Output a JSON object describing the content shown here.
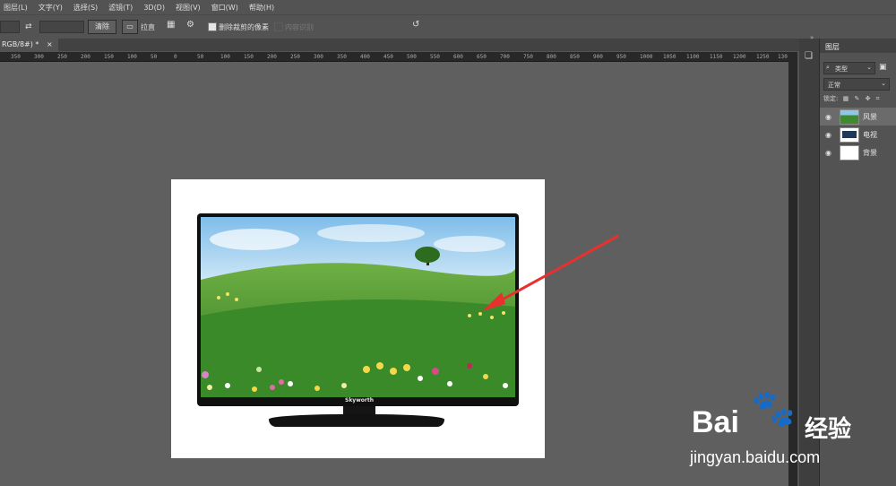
{
  "menubar": {
    "items": [
      "图层(L)",
      "文字(Y)",
      "选择(S)",
      "滤镜(T)",
      "3D(D)",
      "视图(V)",
      "窗口(W)",
      "帮助(H)"
    ]
  },
  "options": {
    "clear_label": "清除",
    "straighten_label": "拉直",
    "delete_cropped_label": "删除裁剪的像素",
    "content_aware_label": "内容识别"
  },
  "document": {
    "tab_title": "RGB/8#) *",
    "tab_close": "×"
  },
  "ruler": {
    "ticks": [
      "350",
      "300",
      "250",
      "200",
      "150",
      "100",
      "50",
      "0",
      "50",
      "100",
      "150",
      "200",
      "250",
      "300",
      "350",
      "400",
      "450",
      "500",
      "550",
      "600",
      "650",
      "700",
      "750",
      "800",
      "850",
      "900",
      "950",
      "1000",
      "1050",
      "1100",
      "1150",
      "1200",
      "1250",
      "130"
    ]
  },
  "tv": {
    "brand": "Skyworth"
  },
  "layers_panel": {
    "title": "图层",
    "filter_label": "类型",
    "blend_mode": "正常",
    "lock_label": "锁定:",
    "layers": [
      {
        "name": "风景",
        "selected": true
      },
      {
        "name": "电视",
        "selected": false
      },
      {
        "name": "背景",
        "selected": false
      }
    ]
  },
  "watermark": {
    "brand": "Bai",
    "brand_suffix": "经验",
    "url": "jingyan.baidu.com"
  },
  "colors": {
    "arrow": "#e8312f",
    "ui_bg": "#535353",
    "canvas_bg": "#5f5f5f"
  }
}
